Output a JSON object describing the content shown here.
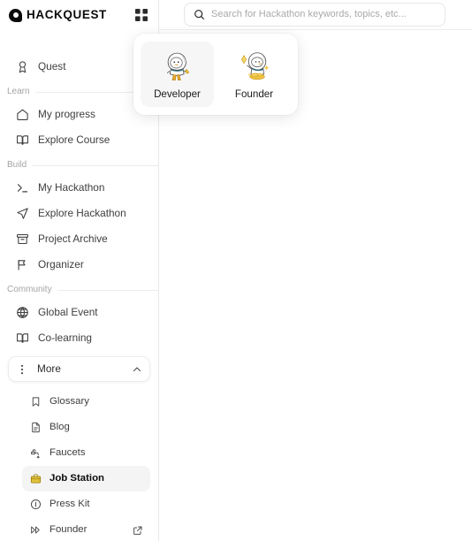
{
  "brand": {
    "name": "HACKQUEST",
    "logo_icon": "hackquest-logo-mark",
    "grid_icon": "grid-apps-icon"
  },
  "search": {
    "placeholder": "Search for Hackathon keywords, topics, etc...",
    "value": "",
    "icon": "search-icon"
  },
  "role_popup": {
    "visible": true,
    "selected": "Developer",
    "options": [
      {
        "label": "Developer",
        "icon": "duck-developer-mascot",
        "selected": true
      },
      {
        "label": "Founder",
        "icon": "duck-founder-mascot",
        "selected": false
      }
    ]
  },
  "sidebar": {
    "top_items": [
      {
        "label": "Quest",
        "icon": "medal-icon"
      }
    ],
    "sections": [
      {
        "title": "Learn",
        "items": [
          {
            "label": "My progress",
            "icon": "home-icon"
          },
          {
            "label": "Explore Course",
            "icon": "book-open-icon"
          }
        ]
      },
      {
        "title": "Build",
        "items": [
          {
            "label": "My Hackathon",
            "icon": "terminal-prompt-icon"
          },
          {
            "label": "Explore Hackathon",
            "icon": "navigation-send-icon"
          },
          {
            "label": "Project Archive",
            "icon": "archive-box-icon"
          },
          {
            "label": "Organizer",
            "icon": "flag-icon"
          }
        ]
      },
      {
        "title": "Community",
        "items": [
          {
            "label": "Global Event",
            "icon": "globe-icon"
          },
          {
            "label": "Co-learning",
            "icon": "book-open-icon"
          }
        ]
      }
    ],
    "more": {
      "label": "More",
      "icon": "dots-vertical-icon",
      "chevron": "chevron-up-icon",
      "expanded": true,
      "items": [
        {
          "label": "Glossary",
          "icon": "bookmark-icon",
          "active": false,
          "external": false
        },
        {
          "label": "Blog",
          "icon": "document-icon",
          "active": false,
          "external": false
        },
        {
          "label": "Faucets",
          "icon": "faucet-icon",
          "active": false,
          "external": false
        },
        {
          "label": "Job Station",
          "icon": "briefcase-icon",
          "active": true,
          "external": false
        },
        {
          "label": "Press Kit",
          "icon": "info-circle-icon",
          "active": false,
          "external": false
        },
        {
          "label": "Founder",
          "icon": "fast-forward-icon",
          "active": false,
          "external": true
        }
      ]
    }
  },
  "colors": {
    "accent_gold": "#C8A21A",
    "active_bg": "#F4F4F4",
    "text_primary": "#0B0B0B",
    "text_secondary": "#3E3E3E",
    "text_muted": "#A4A4A4",
    "border": "#E9E9E9"
  },
  "main": {
    "content": ""
  }
}
